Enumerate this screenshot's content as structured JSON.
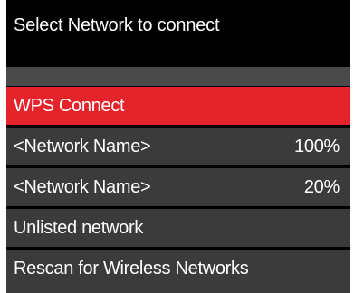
{
  "screen": {
    "title": "Select Network to connect"
  },
  "menu": {
    "items": [
      {
        "label": "WPS Connect",
        "value": "",
        "selected": true
      },
      {
        "label": "<Network Name>",
        "value": "100%",
        "selected": false
      },
      {
        "label": "<Network Name>",
        "value": "20%",
        "selected": false
      },
      {
        "label": "Unlisted network",
        "value": "",
        "selected": false
      },
      {
        "label": "Rescan for Wireless Networks",
        "value": "",
        "selected": false
      }
    ]
  },
  "colors": {
    "background": "#000000",
    "selected": "#e4242a",
    "item": "#3b3b3b",
    "separator": "#4a4a4a",
    "text": "#ffffff"
  }
}
